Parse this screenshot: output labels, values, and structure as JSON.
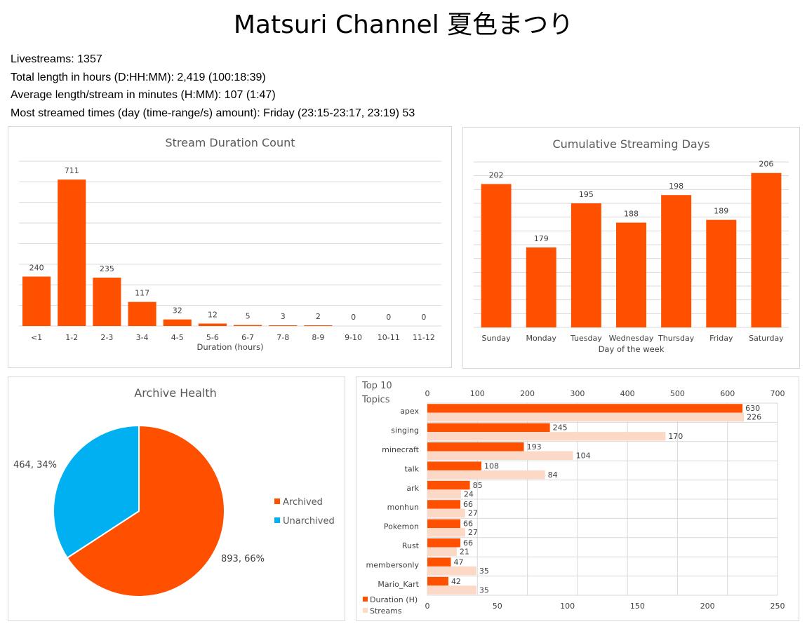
{
  "page_title": "Matsuri Channel 夏色まつり",
  "stats": [
    "Livestreams: 1357",
    "Total length in hours (D:HH:MM): 2,419 (100:18:39)",
    "Average length/stream in minutes (H:MM): 107 (1:47)",
    "Most streamed times (day (time-range/s) amount): Friday (23:15-23:17, 23:19) 53"
  ],
  "colors": {
    "orange": "#ff5000",
    "light": "#fcd9c6",
    "blue": "#00b0f0",
    "grid": "#d9d9d9"
  },
  "chart_data": [
    {
      "type": "bar",
      "title": "Stream Duration Count",
      "xlabel": "Duration (hours)",
      "categories": [
        "<1",
        "1-2",
        "2-3",
        "3-4",
        "4-5",
        "5-6",
        "6-7",
        "7-8",
        "8-9",
        "9-10",
        "10-11",
        "11-12"
      ],
      "values": [
        240,
        711,
        235,
        117,
        32,
        12,
        5,
        3,
        2,
        0,
        0,
        0
      ],
      "ylim": [
        0,
        800
      ],
      "grid": true
    },
    {
      "type": "bar",
      "title": "Cumulative Streaming Days",
      "xlabel": "Day of the week",
      "categories": [
        "Sunday",
        "Monday",
        "Tuesday",
        "Wednesday",
        "Thursday",
        "Friday",
        "Saturday"
      ],
      "values": [
        202,
        179,
        195,
        188,
        198,
        189,
        206
      ],
      "ylim": [
        150,
        210
      ],
      "grid": true
    },
    {
      "type": "pie",
      "title": "Archive Health",
      "categories": [
        "Archived",
        "Unarchived"
      ],
      "values": [
        893,
        464
      ],
      "labels": [
        "893, 66%",
        "464, 34%"
      ],
      "legend": "right"
    },
    {
      "type": "bar",
      "orientation": "horizontal",
      "title": "Top 10 Topics",
      "categories": [
        "apex",
        "singing",
        "minecraft",
        "talk",
        "ark",
        "monhun",
        "Pokemon",
        "Rust",
        "membersonly",
        "Mario_Kart"
      ],
      "series": [
        {
          "name": "Duration (H)",
          "values": [
            630,
            245,
            193,
            108,
            85,
            66,
            66,
            66,
            47,
            42
          ],
          "axis": "top",
          "xlim": [
            0,
            700
          ],
          "ticks": [
            0,
            100,
            200,
            300,
            400,
            500,
            600,
            700
          ]
        },
        {
          "name": "Streams",
          "values": [
            226,
            170,
            104,
            84,
            24,
            27,
            27,
            21,
            35,
            35
          ],
          "axis": "bottom",
          "xlim": [
            0,
            250
          ],
          "ticks": [
            0,
            50,
            100,
            150,
            200,
            250
          ]
        }
      ],
      "grid": true,
      "legend": "bottom-left"
    }
  ]
}
